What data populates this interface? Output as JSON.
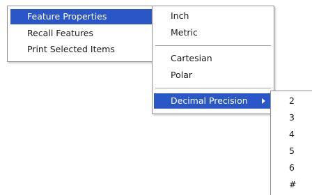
{
  "colors": {
    "highlight": "#2a57c8",
    "border": "#8f8f8f",
    "separator": "#a0a0a0"
  },
  "main_menu": {
    "items": [
      {
        "label": "Feature Properties",
        "submenu": true,
        "highlighted": true
      },
      {
        "label": "Recall Features"
      },
      {
        "label": "Print Selected Items"
      }
    ]
  },
  "units_submenu": {
    "items": [
      {
        "label": "Inch"
      },
      {
        "label": "Metric"
      },
      {
        "label": "Cartesian"
      },
      {
        "label": "Polar"
      },
      {
        "label": "Decimal Precision",
        "submenu": true,
        "highlighted": true
      }
    ]
  },
  "precision_submenu": {
    "items": [
      {
        "label": "2"
      },
      {
        "label": "3"
      },
      {
        "label": "4"
      },
      {
        "label": "5"
      },
      {
        "label": "6"
      },
      {
        "label": "#"
      }
    ]
  },
  "icons": {
    "submenu_arrow": "chevron-right-icon"
  }
}
